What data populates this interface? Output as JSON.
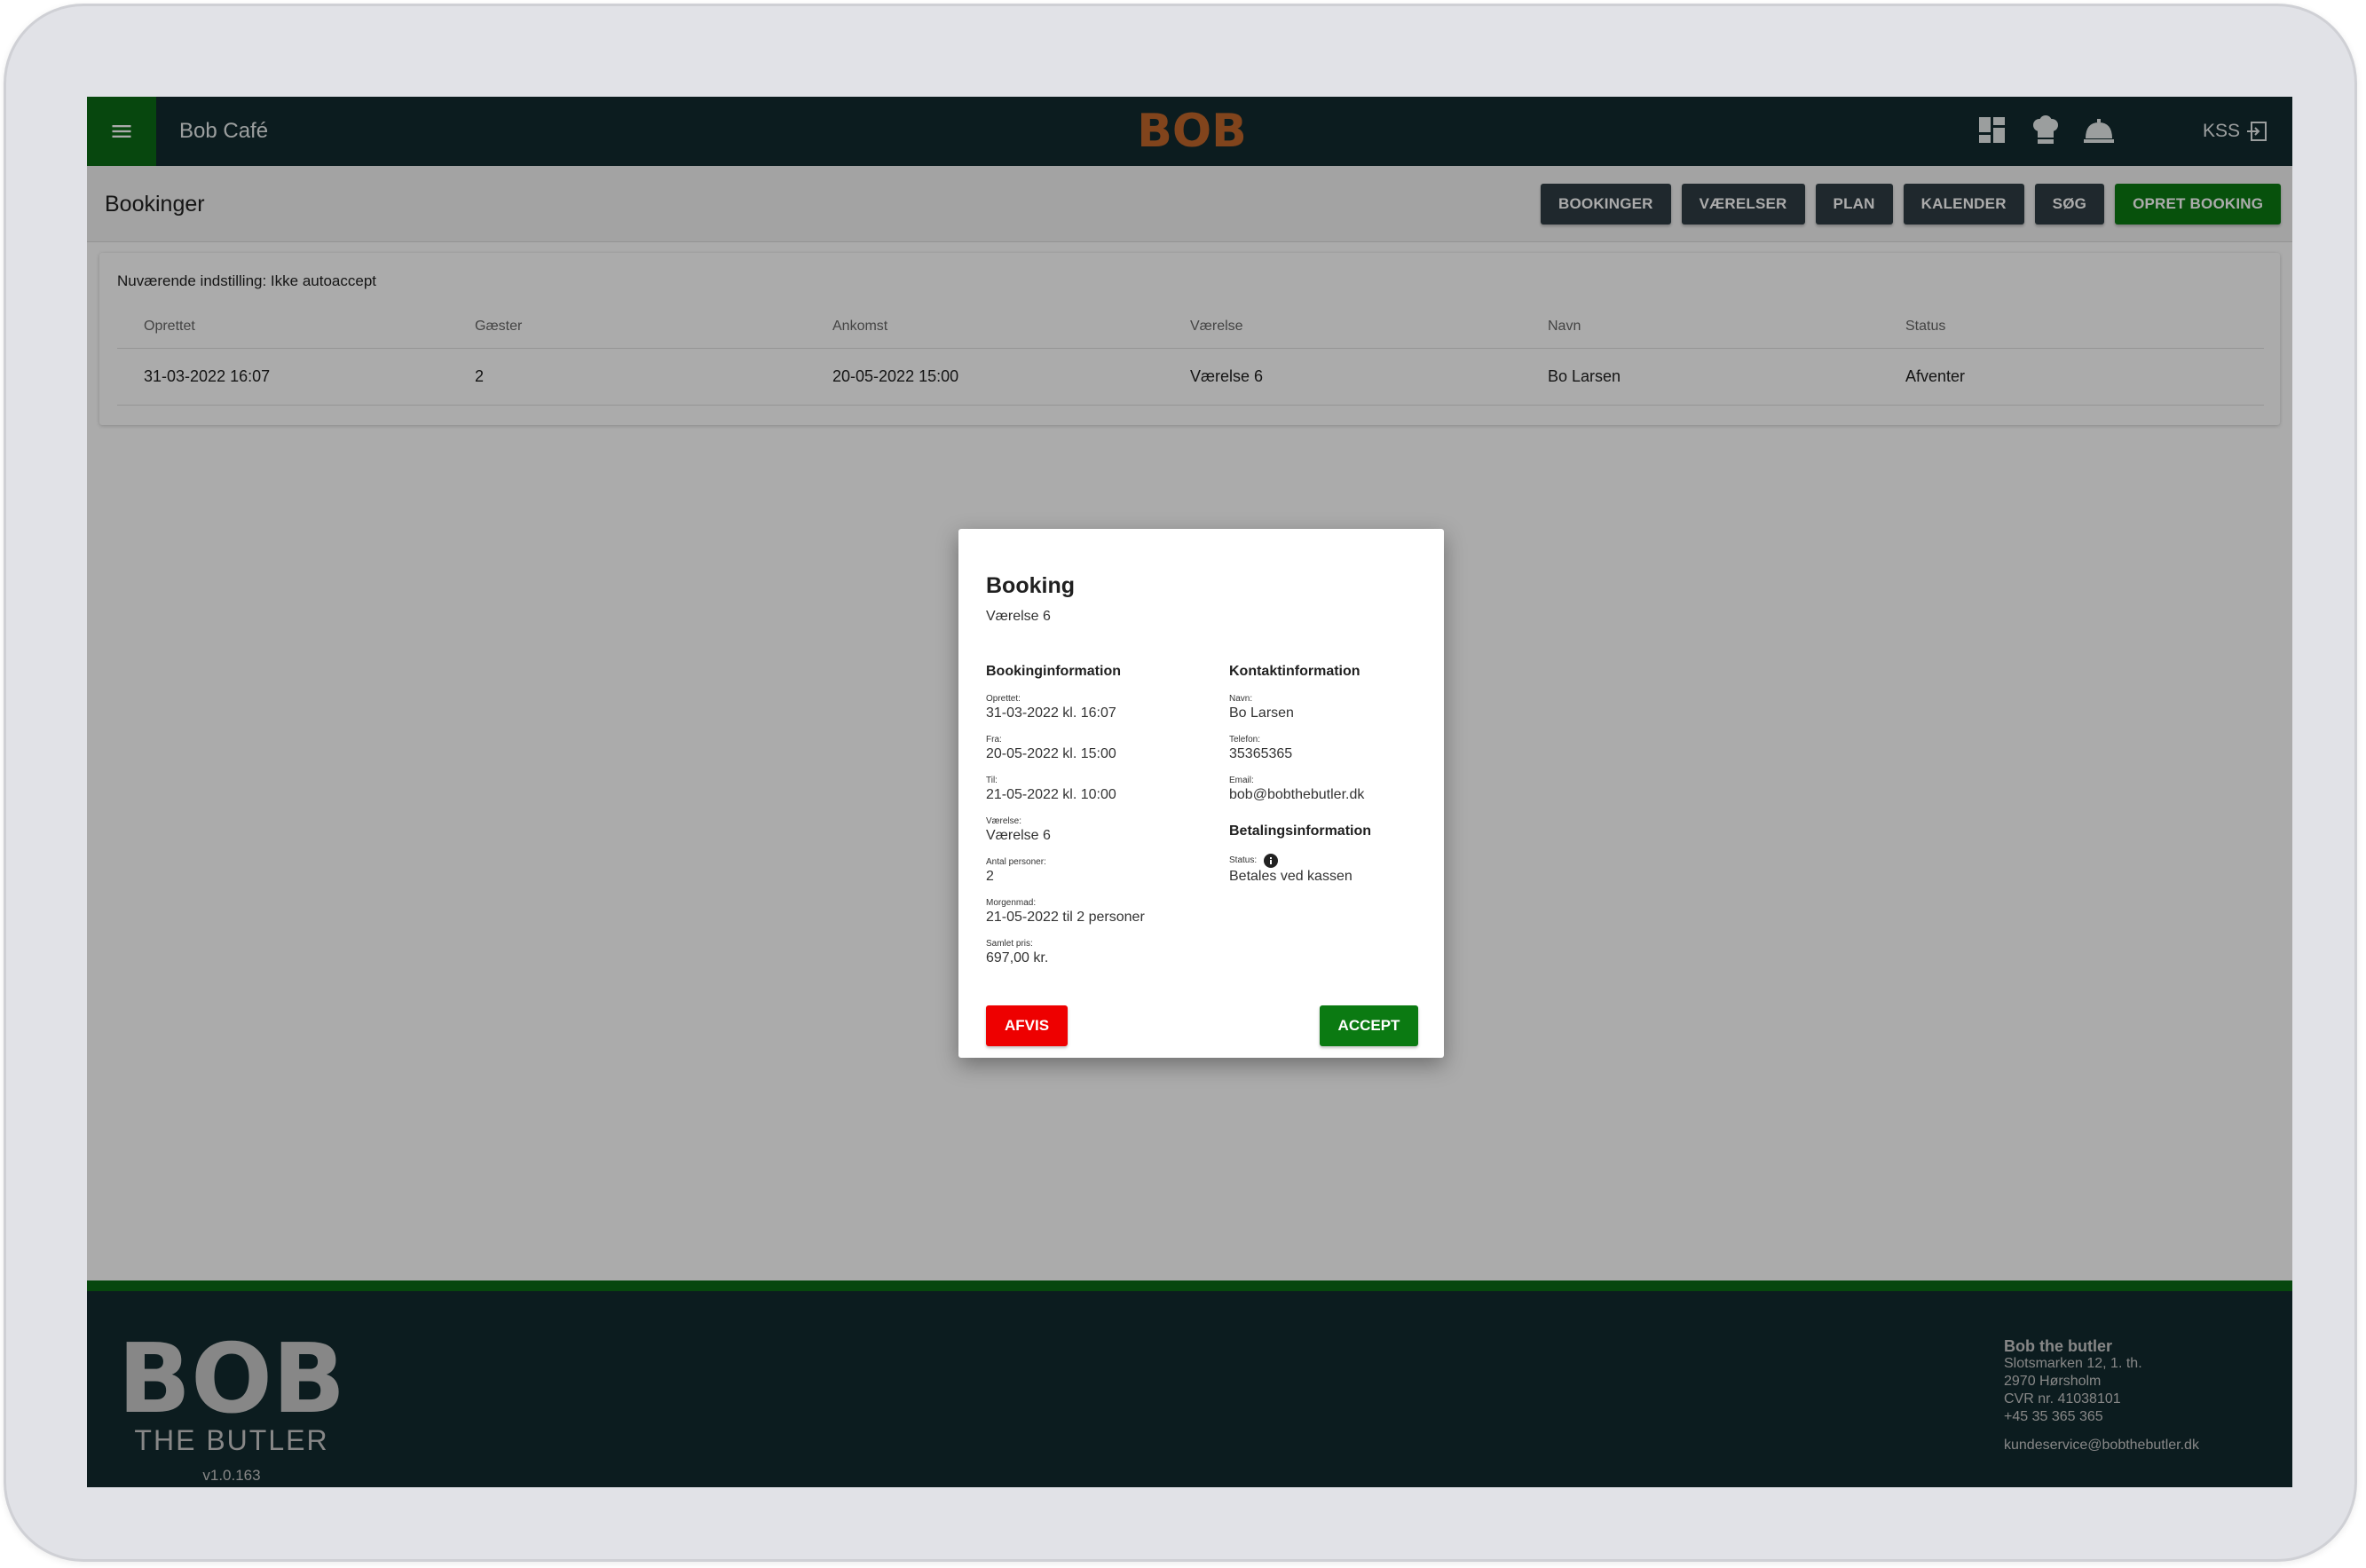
{
  "header": {
    "cafe_name": "Bob Café",
    "logo_text": "BOB",
    "user": "KSS",
    "icons": [
      "dashboard-icon",
      "chef-hat-icon",
      "service-bell-icon",
      "logout-icon"
    ],
    "colors": {
      "topbar": "#132b2f",
      "menu": "#0b6b15",
      "logo": "#c0662a"
    }
  },
  "subheader": {
    "title": "Bookinger",
    "buttons": [
      "BOOKINGER",
      "VÆRELSER",
      "PLAN",
      "KALENDER",
      "SØG",
      "OPRET BOOKING"
    ]
  },
  "bookings": {
    "setting": "Nuværende indstilling: Ikke autoaccept",
    "columns": [
      "Oprettet",
      "Gæster",
      "Ankomst",
      "Værelse",
      "Navn",
      "Status"
    ],
    "rows": [
      [
        "31-03-2022 16:07",
        "2",
        "20-05-2022 15:00",
        "Værelse 6",
        "Bo Larsen",
        "Afventer"
      ]
    ]
  },
  "dialog": {
    "title": "Booking",
    "subtitle": "Værelse 6",
    "booking_section": "Bookinginformation",
    "booking_fields": [
      {
        "label": "Oprettet:",
        "value": "31-03-2022 kl. 16:07"
      },
      {
        "label": "Fra:",
        "value": "20-05-2022 kl. 15:00"
      },
      {
        "label": "Til:",
        "value": "21-05-2022 kl. 10:00"
      },
      {
        "label": "Værelse:",
        "value": "Værelse 6"
      },
      {
        "label": "Antal personer:",
        "value": "2"
      },
      {
        "label": "Morgenmad:",
        "value": "21-05-2022 til 2 personer"
      },
      {
        "label": "Samlet pris:",
        "value": "697,00 kr."
      }
    ],
    "contact_section": "Kontaktinformation",
    "contact_fields": [
      {
        "label": "Navn:",
        "value": "Bo Larsen"
      },
      {
        "label": "Telefon:",
        "value": "35365365"
      },
      {
        "label": "Email:",
        "value": "bob@bobthebutler.dk"
      }
    ],
    "payment_section": "Betalingsinformation",
    "payment_status_label": "Status:",
    "payment_status_value": "Betales ved kassen",
    "reject_label": "AFVIS",
    "accept_label": "ACCEPT"
  },
  "footer": {
    "logo_text": "BOB",
    "tagline": "THE BUTLER",
    "version": "v1.0.163",
    "company": "Bob the butler",
    "address1": "Slotsmarken 12, 1. th.",
    "address2": "2970 Hørsholm",
    "cvr": "CVR nr. 41038101",
    "phone": "+45 35 365 365",
    "email": "kundeservice@bobthebutler.dk"
  }
}
